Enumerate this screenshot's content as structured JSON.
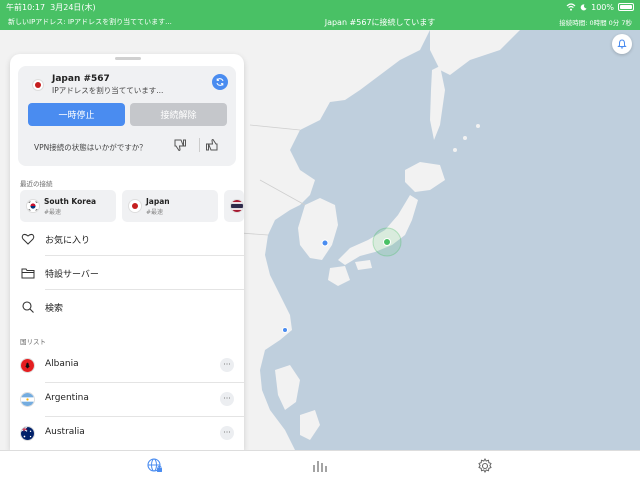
{
  "statusbar": {
    "time": "午前10:17",
    "date": "3月24日(木)",
    "battery": "100%"
  },
  "banner": {
    "left": "新しいIPアドレス: IPアドレスを割り当てています...",
    "center": "Japan #567に接続しています",
    "right": "接続時間: 0時間 0分 7秒"
  },
  "connection": {
    "server": "Japan #567",
    "status": "IPアドレスを割り当てています...",
    "pause_label": "一時停止",
    "disconnect_label": "接続解除",
    "feedback_question": "VPN接続の状態はいかがですか？"
  },
  "recent": {
    "label": "最近の接続",
    "items": [
      {
        "name": "South Korea",
        "sub": "#最速"
      },
      {
        "name": "Japan",
        "sub": "#最速"
      }
    ]
  },
  "menu": {
    "favorites": "お気に入り",
    "specialty": "特設サーバー",
    "search": "検索"
  },
  "countries": {
    "label": "国リスト",
    "items": [
      {
        "name": "Albania"
      },
      {
        "name": "Argentina"
      },
      {
        "name": "Australia"
      }
    ]
  },
  "colors": {
    "accent": "#4a8cf0",
    "connected_green": "#49c165",
    "map_water": "#bfcfdd",
    "land": "#f2f2f2"
  }
}
